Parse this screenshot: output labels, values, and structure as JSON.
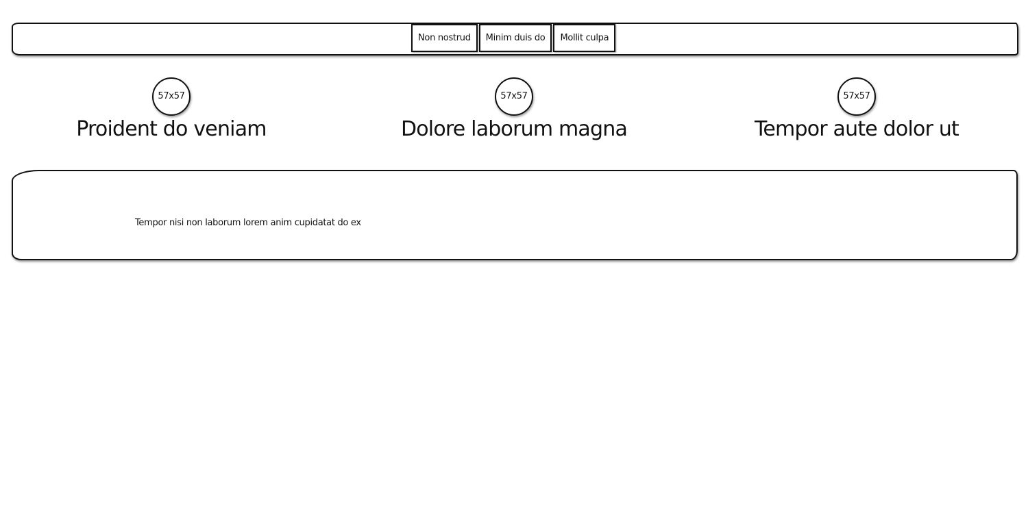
{
  "navbar": {
    "buttons": [
      {
        "label": "Non nostrud"
      },
      {
        "label": "Minim duis do"
      },
      {
        "label": "Mollit culpa"
      }
    ]
  },
  "features": [
    {
      "avatar_text": "57x57",
      "title": "Proident do veniam"
    },
    {
      "avatar_text": "57x57",
      "title": "Dolore laborum magna"
    },
    {
      "avatar_text": "57x57",
      "title": "Tempor aute dolor ut"
    }
  ],
  "content": {
    "text": "Tempor nisi non laborum lorem anim cupidatat do ex"
  }
}
